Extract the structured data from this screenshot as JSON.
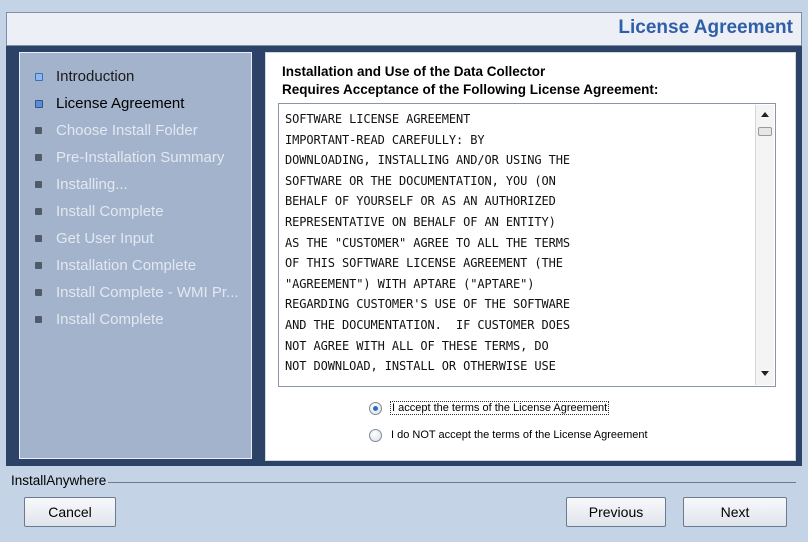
{
  "header": {
    "title": "License Agreement"
  },
  "steps": [
    {
      "label": "Introduction",
      "state": "done"
    },
    {
      "label": "License Agreement",
      "state": "active"
    },
    {
      "label": "Choose Install Folder",
      "state": "pending"
    },
    {
      "label": "Pre-Installation Summary",
      "state": "pending"
    },
    {
      "label": "Installing...",
      "state": "pending"
    },
    {
      "label": "Install Complete",
      "state": "pending"
    },
    {
      "label": "Get User Input",
      "state": "pending"
    },
    {
      "label": "Installation Complete",
      "state": "pending"
    },
    {
      "label": "Install Complete - WMI Pr...",
      "state": "pending"
    },
    {
      "label": "Install Complete",
      "state": "pending"
    }
  ],
  "content": {
    "heading_line1": "Installation and Use of the Data Collector",
    "heading_line2": "Requires Acceptance of the Following License Agreement:",
    "license_text": "SOFTWARE LICENSE AGREEMENT\nIMPORTANT-READ CAREFULLY: BY\nDOWNLOADING, INSTALLING AND/OR USING THE\nSOFTWARE OR THE DOCUMENTATION, YOU (ON\nBEHALF OF YOURSELF OR AS AN AUTHORIZED\nREPRESENTATIVE ON BEHALF OF AN ENTITY)\nAS THE \"CUSTOMER\" AGREE TO ALL THE TERMS\nOF THIS SOFTWARE LICENSE AGREEMENT (THE\n\"AGREEMENT\") WITH APTARE (\"APTARE\")\nREGARDING CUSTOMER'S USE OF THE SOFTWARE\nAND THE DOCUMENTATION.  IF CUSTOMER DOES\nNOT AGREE WITH ALL OF THESE TERMS, DO\nNOT DOWNLOAD, INSTALL OR OTHERWISE USE",
    "accept_label": "I accept the terms of the License Agreement",
    "decline_label": "I do NOT accept the terms of the License Agreement",
    "accept_selected": true
  },
  "footer": {
    "brand": "InstallAnywhere",
    "cancel_label": "Cancel",
    "previous_label": "Previous",
    "next_label": "Next"
  }
}
